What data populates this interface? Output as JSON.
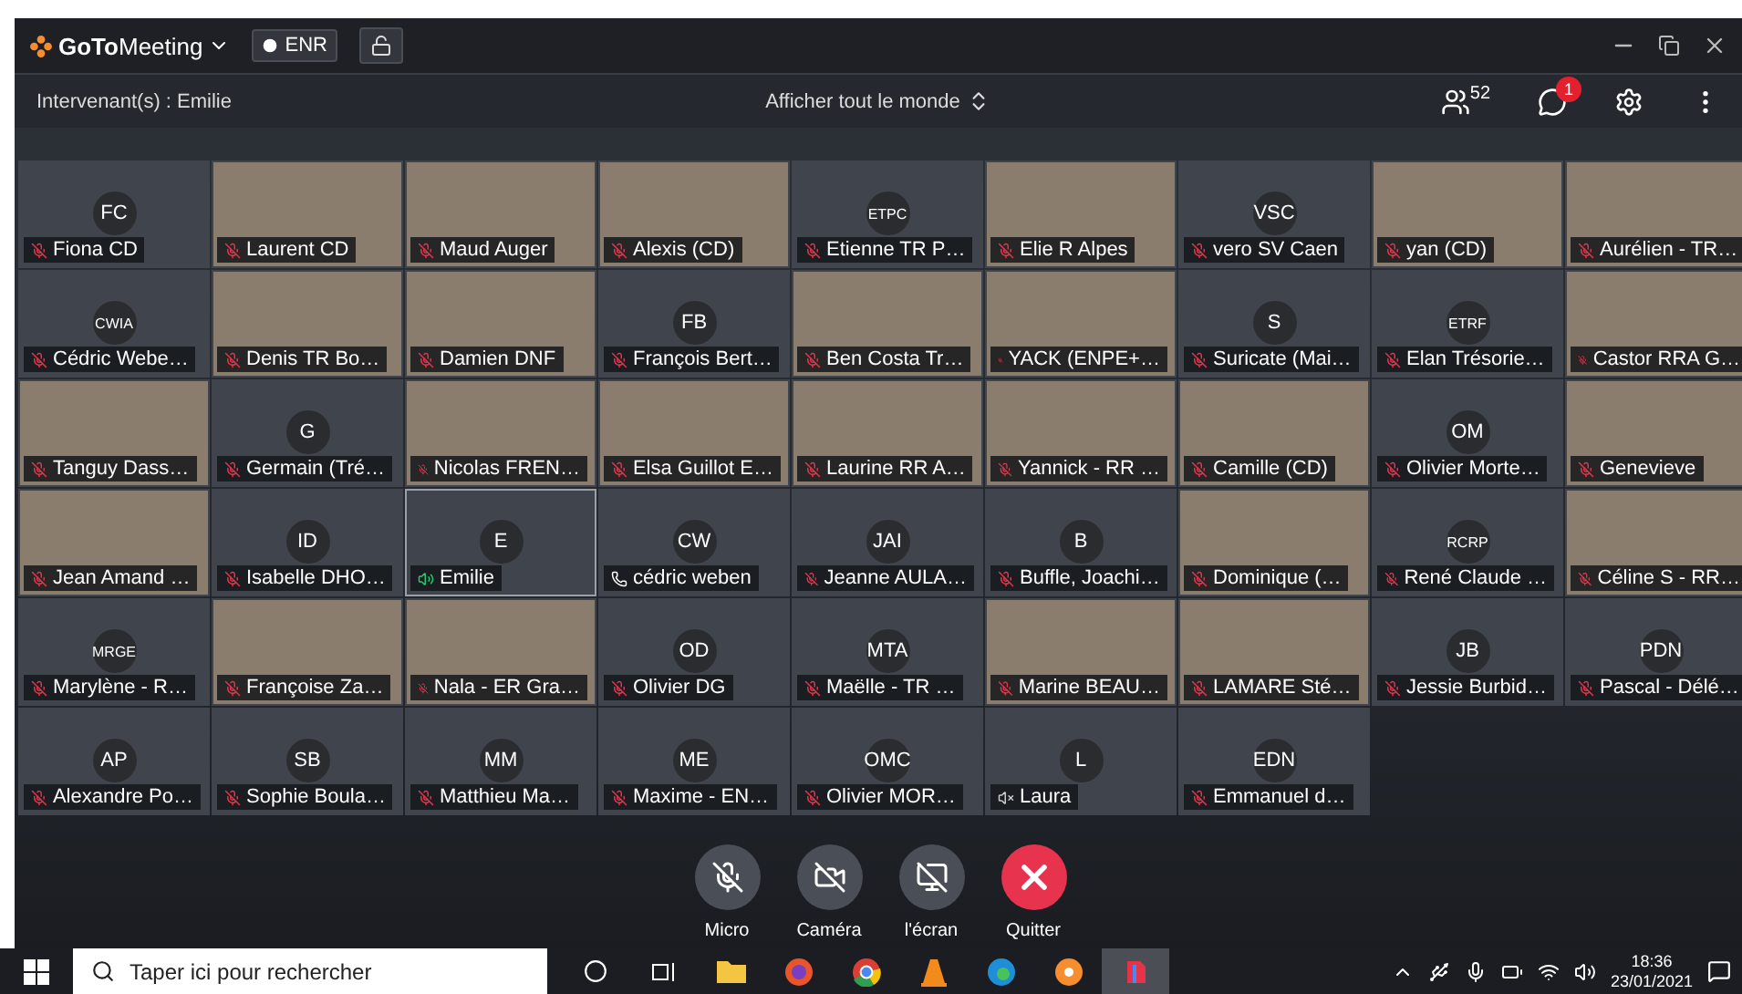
{
  "window": {
    "app_name_bold": "GoTo",
    "app_name": "Meeting",
    "recording": "ENR"
  },
  "toolbar": {
    "speaker_label": "Intervenant(s) : Emilie",
    "view_mode": "Afficher tout le monde",
    "attendee_count": "52",
    "chat_badge": "1"
  },
  "participants": [
    {
      "name": "Fiona CD",
      "initials": "FC",
      "kind": "muted"
    },
    {
      "name": "Laurent CD",
      "kind": "muted"
    },
    {
      "name": "Maud Auger",
      "kind": "muted"
    },
    {
      "name": "Alexis (CD)",
      "kind": "muted"
    },
    {
      "name": "Etienne TR P…",
      "initials": "ETPC",
      "kind": "muted"
    },
    {
      "name": "Elie R Alpes",
      "kind": "muted"
    },
    {
      "name": "vero SV Caen",
      "initials": "VSC",
      "kind": "muted"
    },
    {
      "name": "yan (CD)",
      "kind": "muted"
    },
    {
      "name": "Aurélien - TR…",
      "kind": "muted"
    },
    {
      "name": "Cédric Webe…",
      "initials": "CWIA",
      "kind": "muted"
    },
    {
      "name": "Denis TR Bo…",
      "kind": "muted"
    },
    {
      "name": "Damien DNF",
      "kind": "muted"
    },
    {
      "name": "François Bert…",
      "initials": "FB",
      "kind": "muted"
    },
    {
      "name": "Ben Costa Tr…",
      "kind": "muted"
    },
    {
      "name": "YACK (ENPE+…",
      "kind": "muted"
    },
    {
      "name": "Suricate (Mai…",
      "initials": "S",
      "kind": "muted"
    },
    {
      "name": "Elan Trésorie…",
      "initials": "ETRF",
      "kind": "muted"
    },
    {
      "name": "Castor RRA G…",
      "kind": "muted"
    },
    {
      "name": "Tanguy Dass…",
      "kind": "muted"
    },
    {
      "name": "Germain (Tré…",
      "initials": "G",
      "kind": "muted"
    },
    {
      "name": "Nicolas FREN…",
      "kind": "muted"
    },
    {
      "name": "Elsa Guillot E…",
      "kind": "muted"
    },
    {
      "name": "Laurine RR A…",
      "kind": "muted"
    },
    {
      "name": "Yannick - RR …",
      "kind": "muted"
    },
    {
      "name": "Camille (CD)",
      "kind": "muted"
    },
    {
      "name": "Olivier Morte…",
      "initials": "OM",
      "kind": "muted"
    },
    {
      "name": "Genevieve",
      "kind": "muted"
    },
    {
      "name": "Jean Amand …",
      "kind": "muted"
    },
    {
      "name": "Isabelle DHO…",
      "initials": "ID",
      "kind": "muted"
    },
    {
      "name": "Emilie",
      "initials": "E",
      "kind": "speaking"
    },
    {
      "name": "cédric weben",
      "initials": "CW",
      "kind": "phone"
    },
    {
      "name": "Jeanne AULA…",
      "initials": "JAI",
      "kind": "muted"
    },
    {
      "name": "Buffle, Joachi…",
      "initials": "B",
      "kind": "muted"
    },
    {
      "name": "Dominique (…",
      "kind": "muted"
    },
    {
      "name": "René Claude …",
      "initials": "RCRP",
      "kind": "muted"
    },
    {
      "name": "Céline S - RR…",
      "kind": "muted"
    },
    {
      "name": "Marylène - R…",
      "initials": "MRGE",
      "kind": "muted"
    },
    {
      "name": "Françoise Za…",
      "kind": "muted"
    },
    {
      "name": "Nala - ER Gra…",
      "kind": "muted"
    },
    {
      "name": "Olivier DG",
      "initials": "OD",
      "kind": "muted"
    },
    {
      "name": "Maëlle - TR …",
      "initials": "MTA",
      "kind": "muted"
    },
    {
      "name": "Marine BEAU…",
      "kind": "muted"
    },
    {
      "name": "LAMARE Sté…",
      "kind": "muted"
    },
    {
      "name": "Jessie Burbid…",
      "initials": "JB",
      "kind": "muted"
    },
    {
      "name": "Pascal - Délé…",
      "initials": "PDN",
      "kind": "muted"
    },
    {
      "name": "Alexandre Po…",
      "initials": "AP",
      "kind": "muted"
    },
    {
      "name": "Sophie Boula…",
      "initials": "SB",
      "kind": "muted"
    },
    {
      "name": "Matthieu Ma…",
      "initials": "MM",
      "kind": "muted"
    },
    {
      "name": "Maxime - EN…",
      "initials": "ME",
      "kind": "muted"
    },
    {
      "name": "Olivier MOR…",
      "initials": "OMC",
      "kind": "muted"
    },
    {
      "name": "Laura",
      "initials": "L",
      "kind": "none"
    },
    {
      "name": "Emmanuel d…",
      "initials": "EDN",
      "kind": "muted"
    }
  ],
  "controls": [
    {
      "label": "Micro",
      "kind": "mic"
    },
    {
      "label": "Caméra",
      "kind": "camera"
    },
    {
      "label": "l'écran",
      "kind": "screen"
    },
    {
      "label": "Quitter",
      "kind": "quit"
    }
  ],
  "taskbar": {
    "search_placeholder": "Taper ici pour rechercher",
    "time": "18:36",
    "date": "23/01/2021"
  }
}
